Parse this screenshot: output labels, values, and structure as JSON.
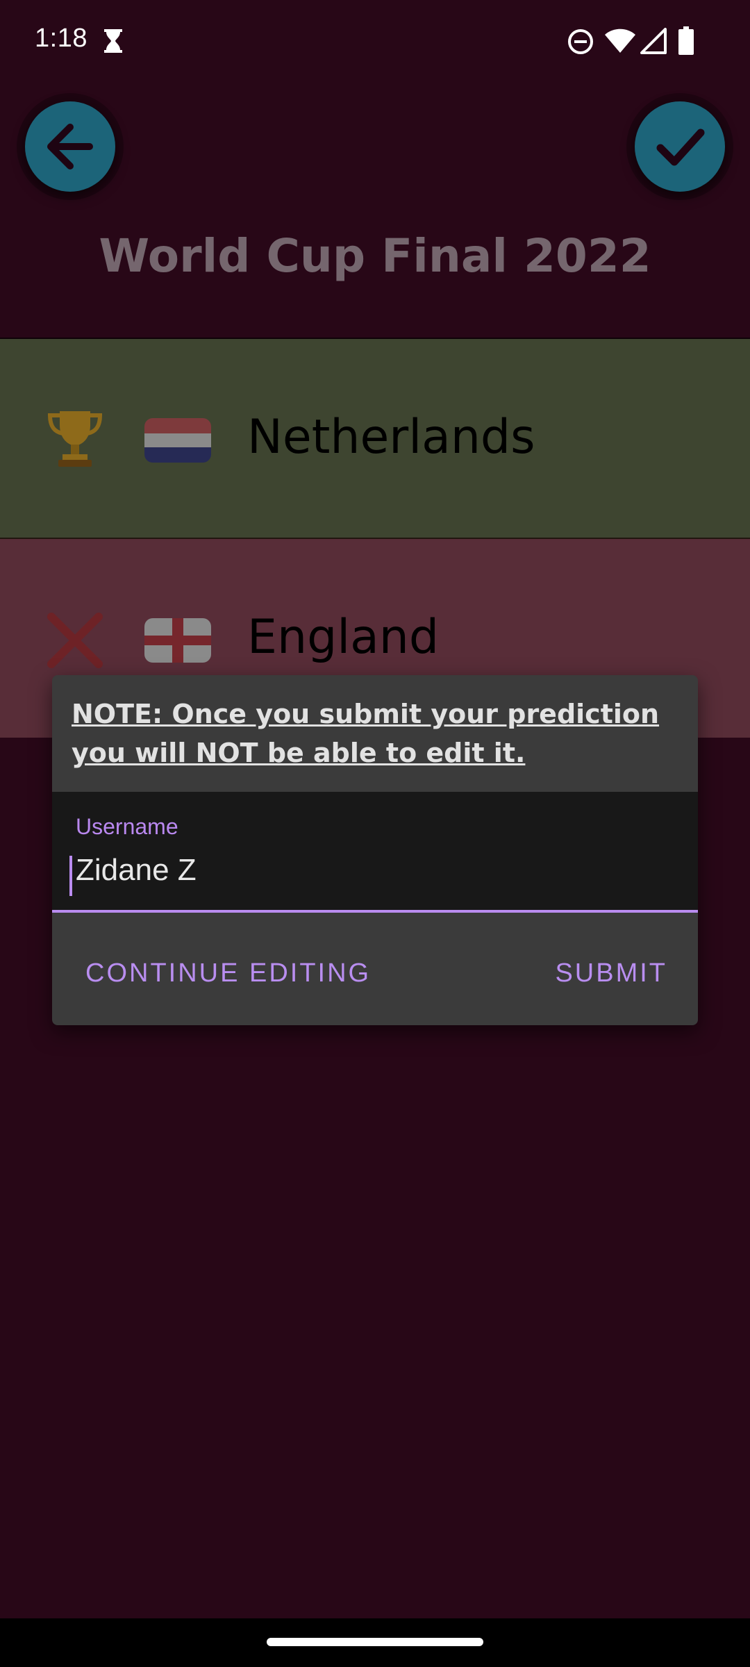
{
  "status_bar": {
    "time": "1:18",
    "icons": [
      "hourglass-icon",
      "do-not-disturb-icon",
      "wifi-icon",
      "signal-icon",
      "battery-icon"
    ]
  },
  "header": {
    "back_icon": "arrow-left-icon",
    "confirm_icon": "check-icon",
    "title": "World Cup Final 2022"
  },
  "teams": [
    {
      "name": "Netherlands",
      "result_icon": "trophy-icon",
      "flag": "netherlands-flag-icon",
      "row_color": "#3e4530"
    },
    {
      "name": "England",
      "result_icon": "cross-icon",
      "flag": "england-flag-icon",
      "row_color": "#582d38"
    }
  ],
  "dialog": {
    "note": "NOTE: Once you submit your prediction you will NOT be able to edit it.",
    "username_label": "Username",
    "username_value": "Zidane Z",
    "continue_label": "CONTINUE EDITING",
    "submit_label": "SUBMIT"
  },
  "colors": {
    "background": "#280717",
    "accent": "#ba8cf0",
    "circle_button": "#1c6479",
    "dialog": "#3b3b3b"
  }
}
